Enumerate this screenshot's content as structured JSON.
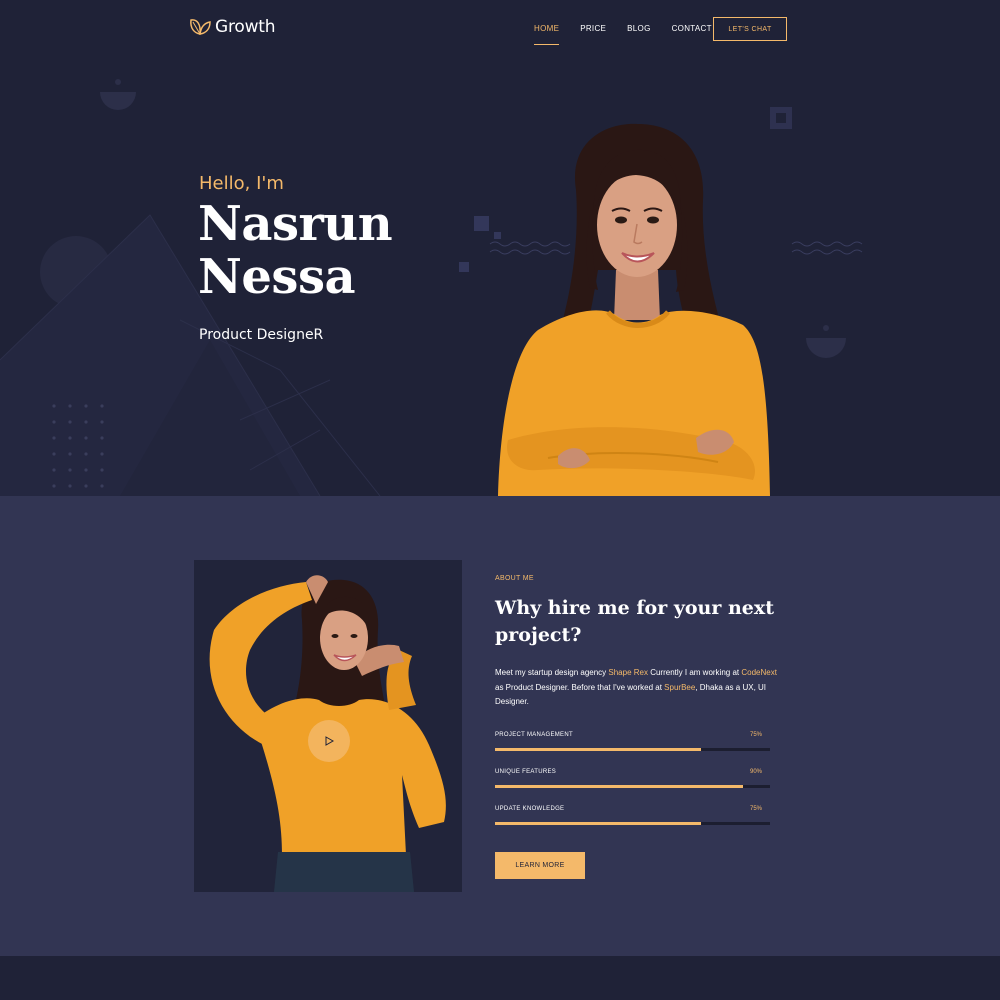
{
  "brand": {
    "name": "Growth"
  },
  "nav": {
    "items": [
      {
        "label": "HOME",
        "active": true
      },
      {
        "label": "PRICE",
        "active": false
      },
      {
        "label": "BLOG",
        "active": false
      },
      {
        "label": "CONTACT",
        "active": false
      }
    ],
    "cta_label": "LET'S CHAT"
  },
  "hero": {
    "greeting": "Hello, I'm",
    "name_line1": "Nasrun",
    "name_line2": "Nessa",
    "role": "Product DesigneR"
  },
  "about": {
    "label": "ABOUT ME",
    "title": "Why hire me for your next project?",
    "text": {
      "part1": "Meet my startup design agency ",
      "link1": "Shape Rex",
      "part2": " Currently I am working at ",
      "link2": "CodeNext",
      "part3": " as Product Designer. Before that I've worked at ",
      "link3": "SpurBee",
      "part4": ", Dhaka as a UX, UI Designer."
    },
    "skills": [
      {
        "name": "PROJECT MANAGEMENT",
        "percent_label": "75%",
        "value": 75
      },
      {
        "name": "UNIQUE FEATURES",
        "percent_label": "90%",
        "value": 90
      },
      {
        "name": "UPDATE KNOWLEDGE",
        "percent_label": "75%",
        "value": 75
      }
    ],
    "button_label": "LEARN MORE"
  },
  "icons": [
    "leaf-logo-icon",
    "play-icon"
  ],
  "colors": {
    "accent": "#f4b96a",
    "hero_bg": "#1f2237",
    "about_bg": "#323553",
    "sweater": "#f0a128"
  }
}
